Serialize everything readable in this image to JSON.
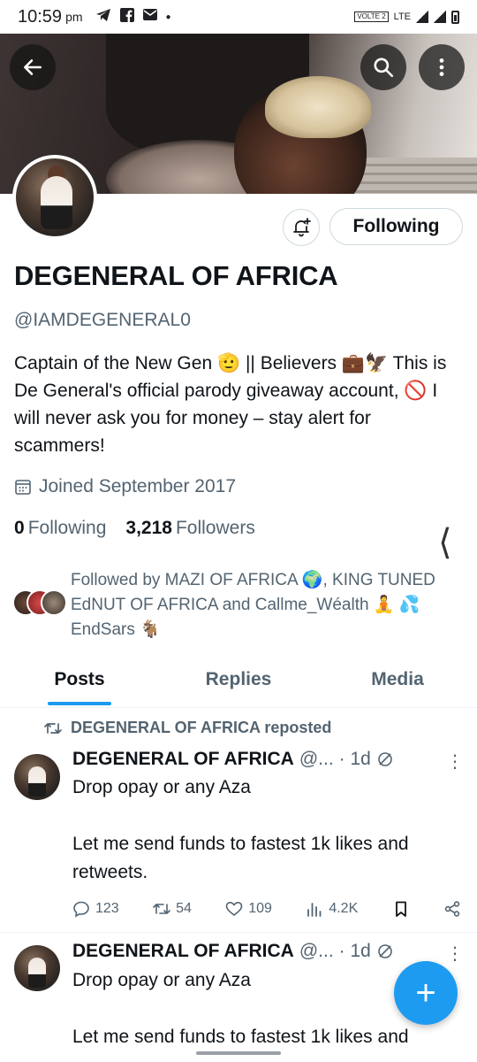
{
  "status_bar": {
    "time": "10:59",
    "ampm": "pm",
    "network": "LTE",
    "volte": "VOLTE 2"
  },
  "header": {
    "back_icon": "arrow-left-icon",
    "search_icon": "search-icon",
    "more_icon": "more-vertical-icon"
  },
  "profile": {
    "name": "DEGENERAL OF AFRICA",
    "handle": "@IAMDEGENERAL0",
    "bio": "Captain of the New Gen 🫡 || Believers 💼🦅 This is De General's official parody giveaway account, 🚫 I will never ask you for money – stay alert for scammers!",
    "joined": "Joined September 2017",
    "following_count": "0",
    "following_label": "Following",
    "followers_count": "3,218",
    "followers_label": "Followers",
    "followed_by": "Followed by MAZI OF AFRICA 🌍, KING TUNED EdNUT OF AFRICA and Callme_Wéalth 🧘 💦EndSars 🐐",
    "follow_button": "Following",
    "edge_handle": "⟨"
  },
  "tabs": [
    "Posts",
    "Replies",
    "Media"
  ],
  "active_tab": "Posts",
  "repost_label": "DEGENERAL OF AFRICA reposted",
  "posts": [
    {
      "name": "DEGENERAL OF AFRICA",
      "handle": "@...",
      "time": "· 1d",
      "text": "Drop opay or any Aza\n\nLet me send funds to fastest 1k likes and retweets.",
      "replies": "123",
      "reposts": "54",
      "likes": "109",
      "views": "4.2K"
    },
    {
      "name": "DEGENERAL OF AFRICA",
      "handle": "@...",
      "time": "· 1d",
      "text": "Drop opay or any Aza\n\nLet me send funds to fastest 1k likes and"
    }
  ],
  "fab_label": "+",
  "colors": {
    "accent": "#1d9bf0",
    "text": "#0f1419",
    "muted": "#536471",
    "border": "#cfd9de"
  }
}
